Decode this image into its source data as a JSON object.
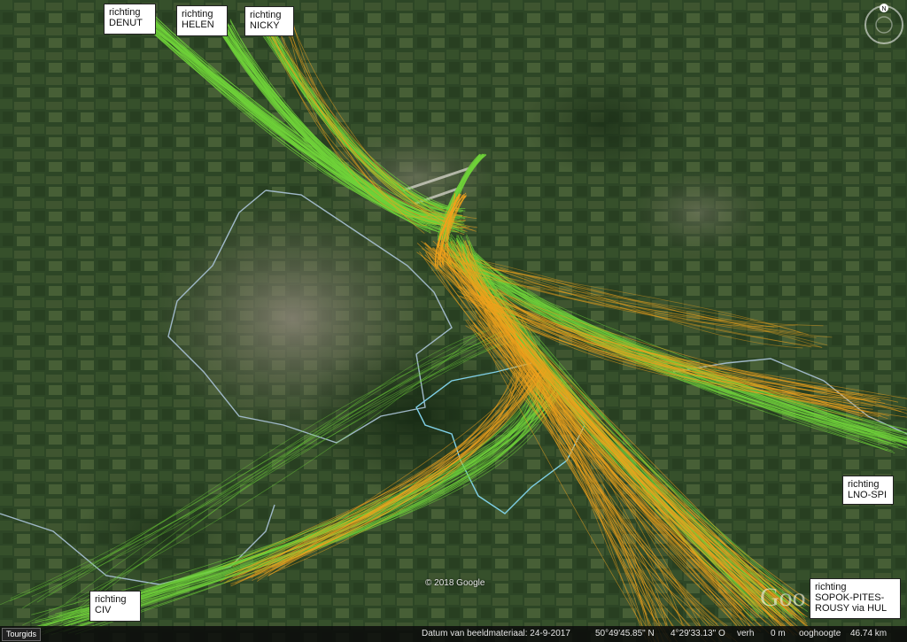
{
  "labels": {
    "denut": [
      "richting",
      "DENUT"
    ],
    "helen": [
      "richting",
      "HELEN"
    ],
    "nicky": [
      "richting",
      "NICKY"
    ],
    "civ": [
      "richting",
      "CIV"
    ],
    "lno": [
      "richting",
      "LNO-SPI"
    ],
    "sopok": [
      "richting",
      "SOPOK-PITES-",
      "ROUSY via HUL"
    ]
  },
  "map": {
    "copyright": "© 2018 Google",
    "watermark": "Goo",
    "compass_letter": "N"
  },
  "statusbar": {
    "tour_button": "Tourgids",
    "date": "Datum van beeldmateriaal: 24-9-2017",
    "lat": "50°49'45.85\" N",
    "lon": "4°29'33.13\" O",
    "elev": "verh",
    "elev_value": "0 m",
    "eye": "ooghoogte",
    "eye_value": "46.74 km"
  },
  "colors": {
    "track_green": "#6fd23a",
    "track_orange": "#f0a21d",
    "border_light": "#9fb8c8",
    "border_cyan": "#7fd0e8",
    "terrain_base": "#2e4527"
  }
}
